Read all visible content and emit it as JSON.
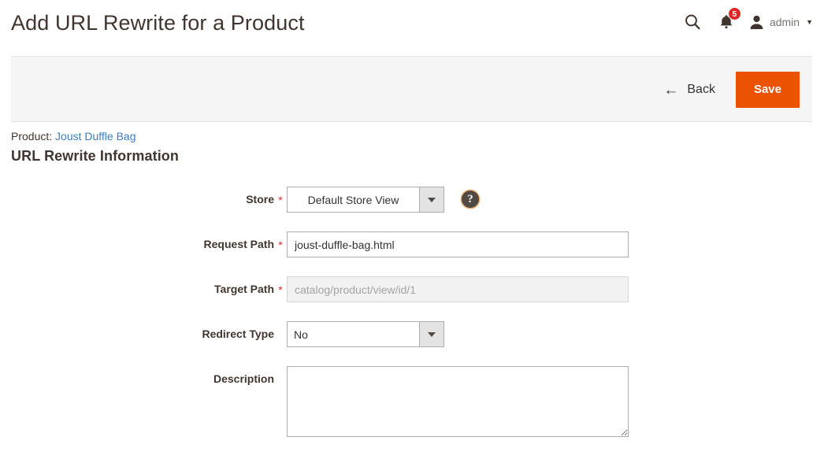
{
  "header": {
    "title": "Add URL Rewrite for a Product",
    "search_icon": "search-icon",
    "notifications_icon": "bell-icon",
    "notifications_count": "5",
    "avatar_icon": "user-avatar-icon",
    "admin_name": "admin",
    "chevron_icon": "chevron-down-icon"
  },
  "action_bar": {
    "back_label": "Back",
    "back_icon": "arrow-left-icon",
    "save_label": "Save"
  },
  "content": {
    "product_label": "Product:",
    "product_name": "Joust Duffle Bag",
    "section_heading": "URL Rewrite Information"
  },
  "form": {
    "store": {
      "label": "Store",
      "required": "*",
      "value": "Default Store View",
      "help_icon": "question-mark-icon",
      "options": [
        "Default Store View"
      ]
    },
    "request_path": {
      "label": "Request Path",
      "required": "*",
      "value": "joust-duffle-bag.html"
    },
    "target_path": {
      "label": "Target Path",
      "required": "*",
      "value": "catalog/product/view/id/1"
    },
    "redirect_type": {
      "label": "Redirect Type",
      "value": "No",
      "options": [
        "No"
      ]
    },
    "description": {
      "label": "Description",
      "value": ""
    }
  },
  "colors": {
    "accent_orange": "#eb5202",
    "badge_red": "#e22626",
    "link_blue": "#3c7dbf",
    "required_red": "#e02b27",
    "bar_gray": "#f5f5f5",
    "text_dark": "#41362f"
  }
}
